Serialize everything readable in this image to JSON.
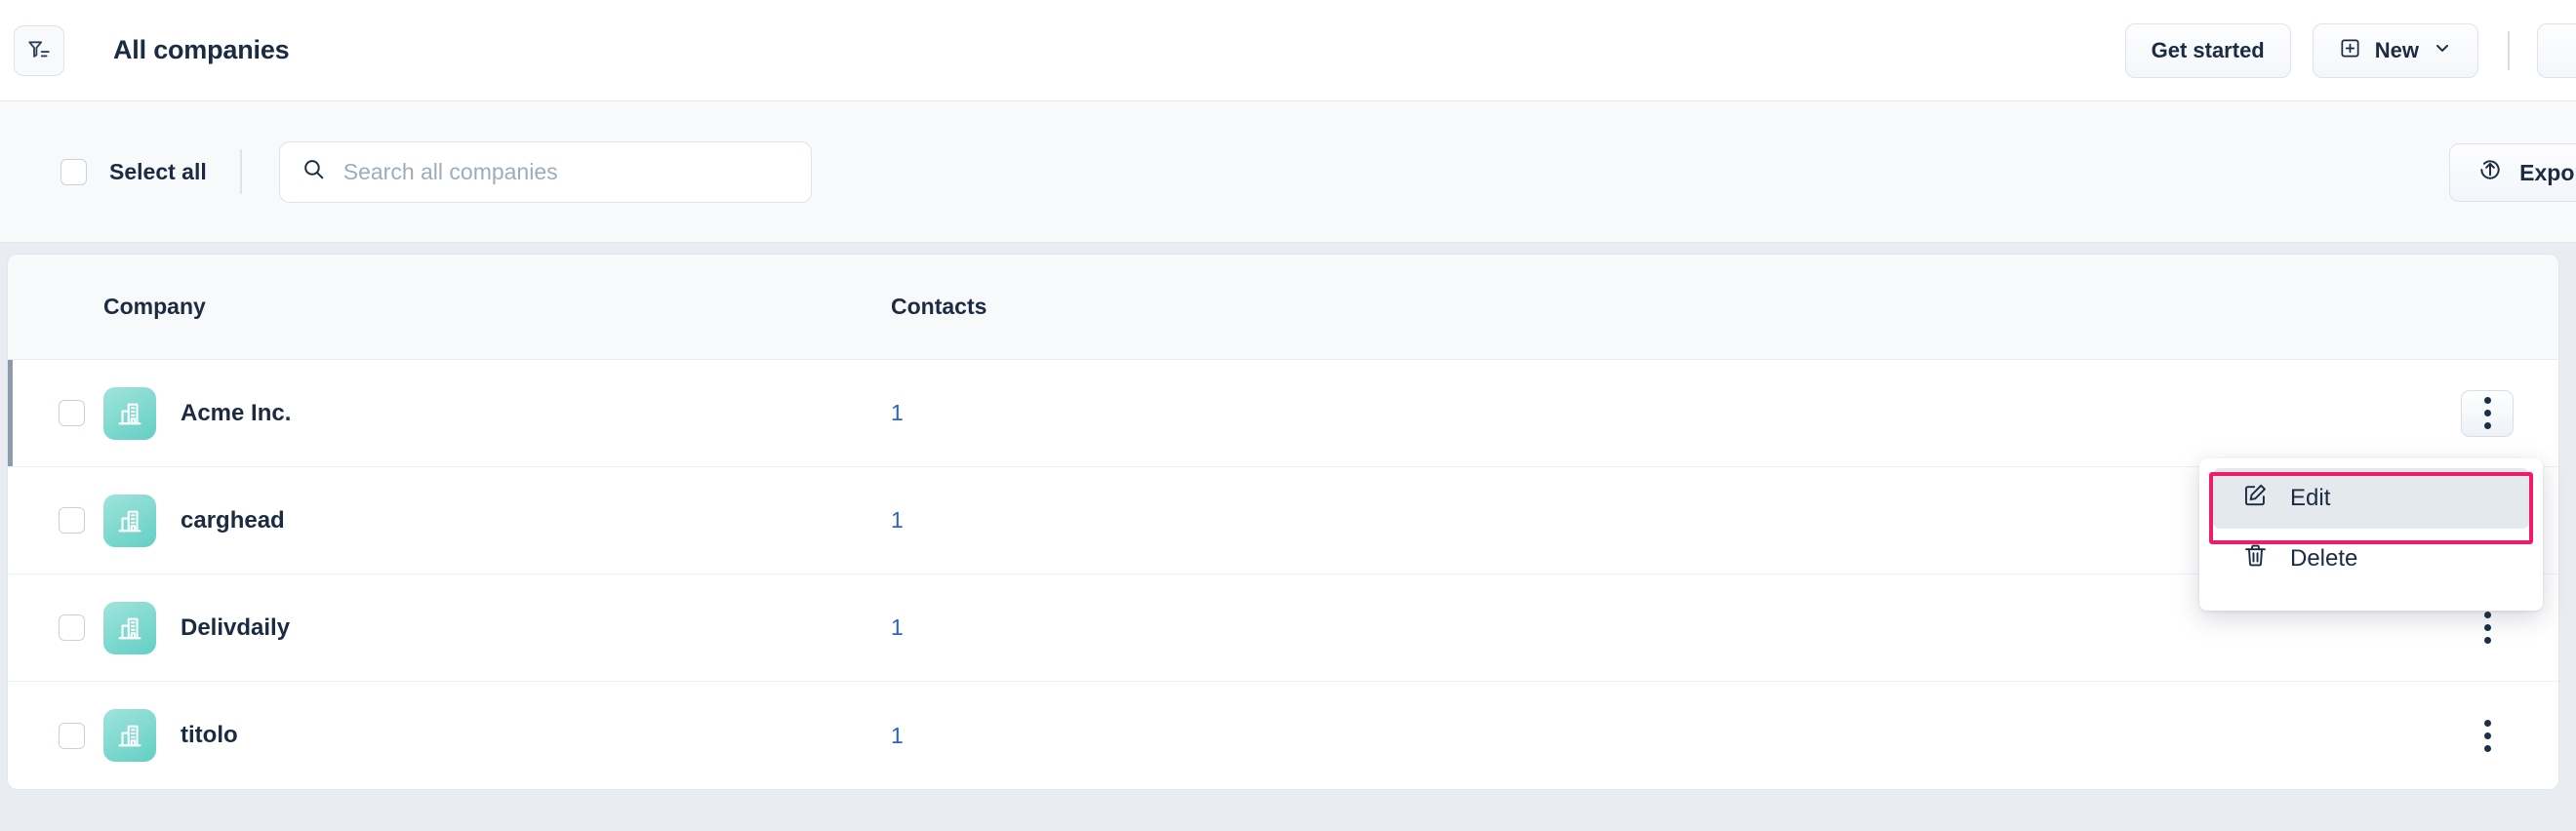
{
  "header": {
    "filter_icon": "filter-icon",
    "title": "All companies",
    "get_started_label": "Get started",
    "new_label": "New",
    "new_icon": "plus-square-icon",
    "new_chevron": "chevron-down-icon"
  },
  "toolbar": {
    "select_all_label": "Select all",
    "search": {
      "icon": "search-icon",
      "placeholder": "Search all companies",
      "value": ""
    },
    "export_label": "Export",
    "export_icon": "export-upload-icon"
  },
  "table": {
    "columns": [
      "Company",
      "Contacts"
    ],
    "rows": [
      {
        "name": "Acme Inc.",
        "contacts": "1",
        "avatar_icon": "company-building-icon",
        "selected": false,
        "active": true
      },
      {
        "name": "carghead",
        "contacts": "1",
        "avatar_icon": "company-building-icon",
        "selected": false,
        "active": false
      },
      {
        "name": "Delivdaily",
        "contacts": "1",
        "avatar_icon": "company-building-icon",
        "selected": false,
        "active": false
      },
      {
        "name": "titolo",
        "contacts": "1",
        "avatar_icon": "company-building-icon",
        "selected": false,
        "active": false
      }
    ]
  },
  "menu": {
    "items": [
      {
        "label": "Edit",
        "icon": "edit-pencil-icon",
        "highlighted": true
      },
      {
        "label": "Delete",
        "icon": "trash-icon",
        "highlighted": false
      }
    ]
  },
  "colors": {
    "page_bg": "#E9EDF2",
    "text": "#1B2B41",
    "link": "#2B62D1",
    "avatar_from": "#9FE4DC",
    "avatar_to": "#63CFC4",
    "highlight": "#F01B6B",
    "row_accent": "#8C9BAB"
  }
}
